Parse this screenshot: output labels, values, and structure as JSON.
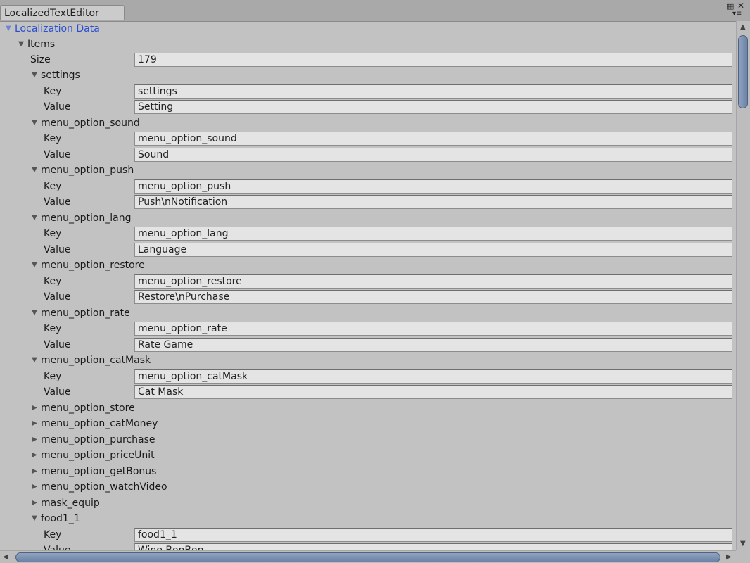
{
  "window": {
    "tab_title": "LocalizedTextEditor",
    "maximize_icon": "maximize-icon",
    "close_icon": "close-icon",
    "menu_icon": "window-menu-icon"
  },
  "inspector": {
    "root_label": "Localization Data",
    "items_label": "Items",
    "size_label": "Size",
    "size_value": "179",
    "key_label": "Key",
    "value_label": "Value",
    "entries": [
      {
        "name": "settings",
        "expanded": true,
        "key": "settings",
        "value": "Setting"
      },
      {
        "name": "menu_option_sound",
        "expanded": true,
        "key": "menu_option_sound",
        "value": "Sound"
      },
      {
        "name": "menu_option_push",
        "expanded": true,
        "key": "menu_option_push",
        "value": "Push\\nNotification"
      },
      {
        "name": "menu_option_lang",
        "expanded": true,
        "key": "menu_option_lang",
        "value": "Language"
      },
      {
        "name": "menu_option_restore",
        "expanded": true,
        "key": "menu_option_restore",
        "value": "Restore\\nPurchase"
      },
      {
        "name": "menu_option_rate",
        "expanded": true,
        "key": "menu_option_rate",
        "value": "Rate Game"
      },
      {
        "name": "menu_option_catMask",
        "expanded": true,
        "key": "menu_option_catMask",
        "value": "Cat Mask"
      },
      {
        "name": "menu_option_store",
        "expanded": false
      },
      {
        "name": "menu_option_catMoney",
        "expanded": false
      },
      {
        "name": "menu_option_purchase",
        "expanded": false
      },
      {
        "name": "menu_option_priceUnit",
        "expanded": false
      },
      {
        "name": "menu_option_getBonus",
        "expanded": false
      },
      {
        "name": "menu_option_watchVideo",
        "expanded": false
      },
      {
        "name": "mask_equip",
        "expanded": false
      },
      {
        "name": "food1_1",
        "expanded": true,
        "key": "food1_1",
        "value": "Wine BonBon"
      }
    ]
  }
}
